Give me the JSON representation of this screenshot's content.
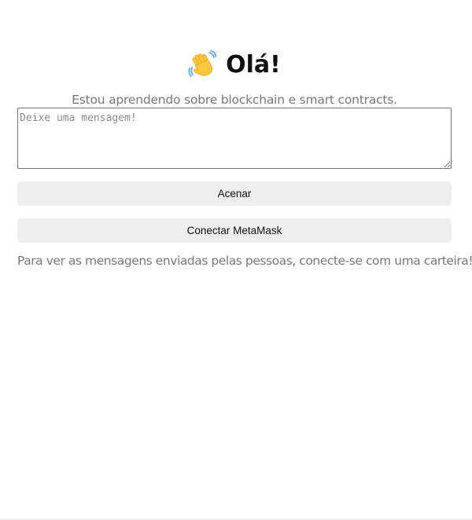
{
  "header": {
    "icon": "waving-hand-icon",
    "title": "Olá!"
  },
  "bio": "Estou aprendendo sobre blockchain e smart contracts.",
  "message": {
    "placeholder": "Deixe uma mensagem!",
    "value": ""
  },
  "buttons": {
    "wave_label": "Acenar",
    "connect_label": "Conectar MetaMask"
  },
  "note": "Para ver as mensagens enviadas pelas pessoas, conecte-se com uma carteira!",
  "colors": {
    "button_bg": "#eeeeee",
    "muted_text": "#777777",
    "title_text": "#111111"
  }
}
